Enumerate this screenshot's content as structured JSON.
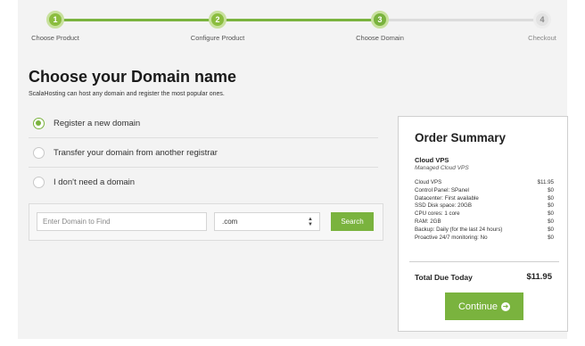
{
  "steps": [
    {
      "number": "1",
      "label": "Choose Product",
      "state": "done"
    },
    {
      "number": "2",
      "label": "Configure Product",
      "state": "done"
    },
    {
      "number": "3",
      "label": "Choose Domain",
      "state": "current"
    },
    {
      "number": "4",
      "label": "Checkout",
      "state": "todo"
    }
  ],
  "page": {
    "title": "Choose your Domain name",
    "subtitle": "ScalaHosting can host any domain and register the most popular ones."
  },
  "domain_options": [
    {
      "label": "Register a new domain",
      "selected": true
    },
    {
      "label": "Transfer your domain from another registrar",
      "selected": false
    },
    {
      "label": "I don't need a domain",
      "selected": false
    }
  ],
  "search": {
    "placeholder": "Enter Domain to Find",
    "value": "",
    "tld_selected": ".com",
    "button_label": "Search"
  },
  "summary": {
    "title": "Order Summary",
    "product_name": "Cloud VPS",
    "product_subtitle": "Managed Cloud VPS",
    "lines": [
      {
        "label": "Cloud VPS",
        "value": "$11.95"
      },
      {
        "label": "Control Panel: SPanel",
        "value": "$0"
      },
      {
        "label": "Datacenter: First available",
        "value": "$0"
      },
      {
        "label": "SSD Disk space: 20GB",
        "value": "$0"
      },
      {
        "label": "CPU cores: 1 core",
        "value": "$0"
      },
      {
        "label": "RAM: 2GB",
        "value": "$0"
      },
      {
        "label": "Backup: Daily (for the last 24 hours)",
        "value": "$0"
      },
      {
        "label": "Proactive 24/7 monitoring: No",
        "value": "$0"
      }
    ],
    "total_label": "Total Due Today",
    "total_value": "$11.95",
    "continue_label": "Continue",
    "continue_icon": "arrow-right-circle-icon"
  },
  "colors": {
    "accent": "#7ab33e",
    "background": "#f3f3f3"
  }
}
